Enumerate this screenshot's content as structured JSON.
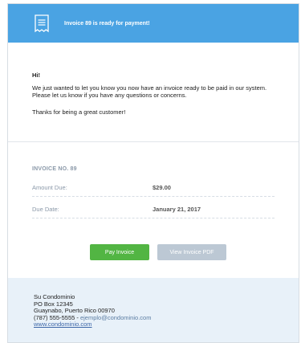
{
  "header": {
    "icon": "receipt-icon",
    "title": "Invoice 89 is ready for payment!",
    "color": "#4aa3e3"
  },
  "message": {
    "greeting": "Hi!",
    "paragraph1": "We just wanted to let you know you now have an invoice ready to be paid in our system. Please let us know if you have any questions or concerns.",
    "paragraph2": "Thanks for being a great customer!"
  },
  "invoice": {
    "number_label": "INVOICE NO. 89",
    "amount_label": "Amount Due:",
    "amount_value": "$29.00",
    "due_label": "Due Date:",
    "due_value": "January 21, 2017"
  },
  "buttons": {
    "pay_label": "Pay Invoice",
    "pdf_label": "View Invoice PDF",
    "pay_color": "#52b543",
    "pdf_color": "#bcc8d4"
  },
  "footer": {
    "name": "Su Condominio",
    "pobox": "PO Box 12345",
    "city": "Guaynabo, Puerto Rico 00970",
    "phone": "(787) 555-5555 - ",
    "email": "ejemplo@condominio.com",
    "website": "www.condominio.com"
  }
}
